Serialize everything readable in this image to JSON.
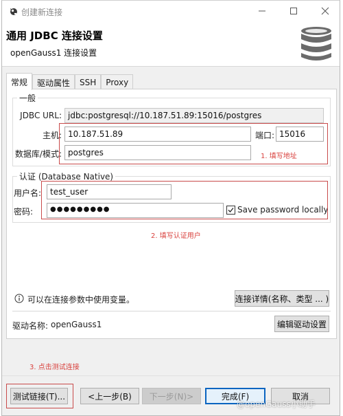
{
  "window": {
    "title": "创建新连接",
    "icons": {
      "app": "dbeaver-beaver-icon",
      "minimize": "minimize-icon",
      "maximize": "maximize-icon",
      "close": "close-icon"
    }
  },
  "header": {
    "title": "通用 JDBC 连接设置",
    "subtitle": "openGauss1 连接设置",
    "icon": "database-icon"
  },
  "tabs": [
    {
      "label": "常规",
      "active": true
    },
    {
      "label": "驱动属性",
      "active": false
    },
    {
      "label": "SSH",
      "active": false
    },
    {
      "label": "Proxy",
      "active": false
    }
  ],
  "general": {
    "legend": "一般",
    "jdbc_url_label": "JDBC URL:",
    "jdbc_url_value": "jdbc:postgresql://10.187.51.89:15016/postgres",
    "host_label": "主机:",
    "host_value": "10.187.51.89",
    "port_label": "端口:",
    "port_value": "15016",
    "database_label": "数据库/模式:",
    "database_value": "postgres"
  },
  "auth": {
    "legend": "认证 (Database Native)",
    "username_label": "用户名:",
    "username_value": "test_user",
    "password_label": "密码:",
    "password_value": "●●●●●●●●●",
    "save_password_label": "Save password locally",
    "save_password_checked": true
  },
  "annotations": {
    "step1": "1. 填写地址",
    "step2": "2. 填写认证用户",
    "step3": "3. 点击测试连接",
    "color": "#d9423e"
  },
  "info": {
    "icon": "info-icon",
    "text": "可以在连接参数中使用变量。",
    "details_button": "连接详情(名称、类型 ... )"
  },
  "driver": {
    "label": "驱动名称:",
    "value": "openGauss1",
    "edit_button": "编辑驱动设置"
  },
  "footer": {
    "test_button": "测试链接(T)...",
    "back_button": "<上一步(B)",
    "next_button": "下一步(N)>",
    "finish_button": "完成(F)",
    "cancel_button": "取消"
  },
  "watermark": "@openGauss小助手"
}
